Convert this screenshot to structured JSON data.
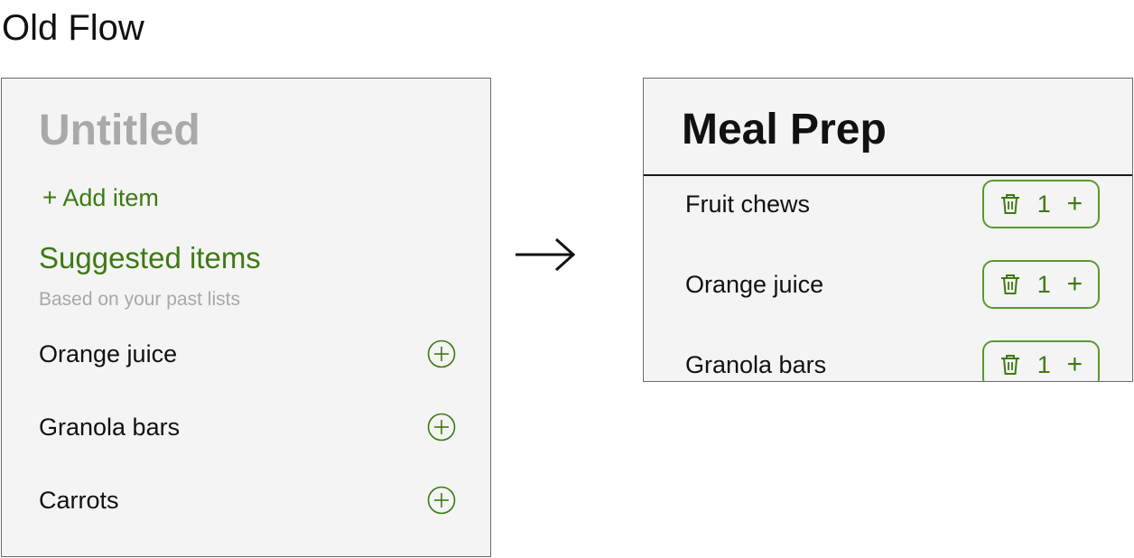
{
  "heading": "Old Flow",
  "left_panel": {
    "list_title": "Untitled",
    "add_item_label": "Add item",
    "suggested_title": "Suggested items",
    "suggested_subtitle": "Based on your past lists",
    "suggested_items": [
      {
        "name": "Orange juice"
      },
      {
        "name": "Granola bars"
      },
      {
        "name": "Carrots"
      }
    ]
  },
  "right_panel": {
    "list_title": "Meal Prep",
    "items": [
      {
        "name": "Fruit chews",
        "quantity": "1"
      },
      {
        "name": "Orange juice",
        "quantity": "1"
      },
      {
        "name": "Granola bars",
        "quantity": "1"
      }
    ]
  },
  "colors": {
    "accent_green": "#3d7a12",
    "panel_background": "#f4f4f4",
    "placeholder_gray": "#a9a9a9"
  },
  "icons": {
    "arrow": "arrow-right-icon",
    "add": "plus-icon",
    "add_suggestion": "circle-plus-icon",
    "remove": "trash-icon"
  }
}
